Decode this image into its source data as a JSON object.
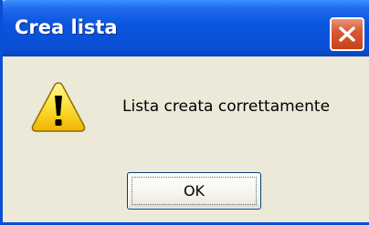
{
  "window": {
    "title": "Crea lista"
  },
  "dialog": {
    "icon": "warning-icon",
    "message": "Lista creata correttamente",
    "ok_label": "OK"
  },
  "colors": {
    "titlebar": "#0a55de",
    "close_button": "#d65a32",
    "dialog_background": "#ece9d8"
  }
}
